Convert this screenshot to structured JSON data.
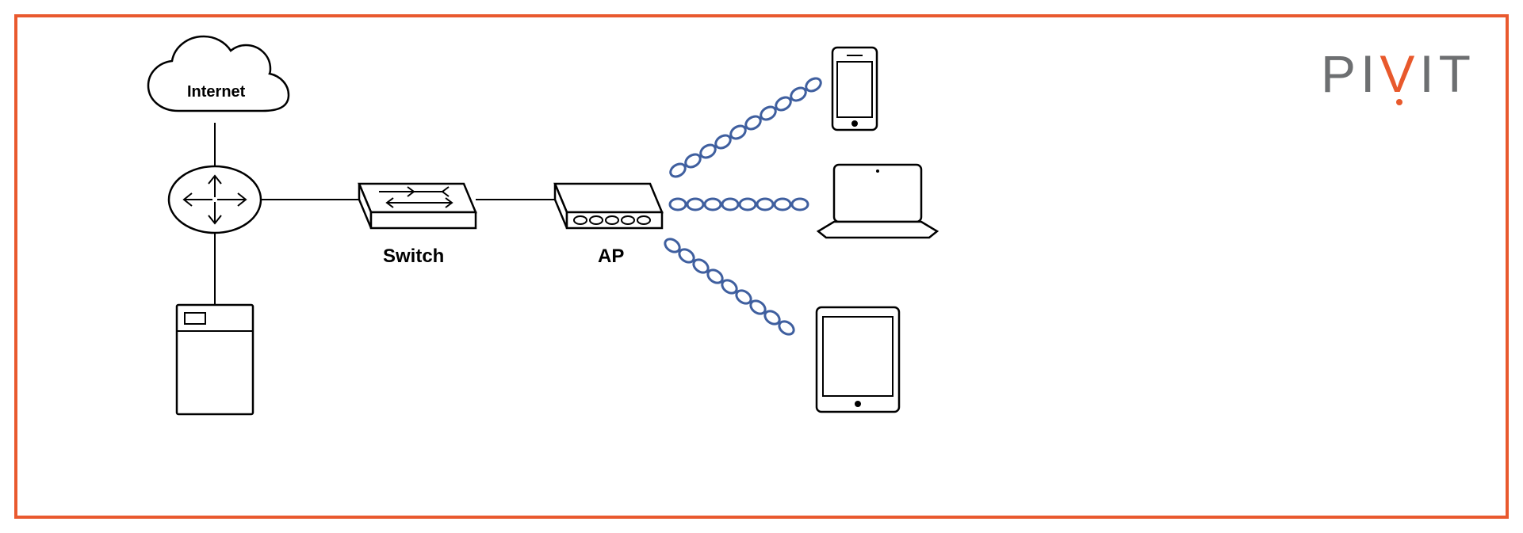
{
  "brand": {
    "name": "PIVIT"
  },
  "diagram": {
    "nodes": {
      "internet": {
        "label": "Internet"
      },
      "router": {
        "label": ""
      },
      "server": {
        "label": ""
      },
      "switch": {
        "label": "Switch"
      },
      "ap": {
        "label": "AP"
      },
      "phone": {
        "label": ""
      },
      "laptop": {
        "label": ""
      },
      "tablet": {
        "label": ""
      }
    },
    "links": [
      {
        "from": "internet",
        "to": "router",
        "type": "wired"
      },
      {
        "from": "router",
        "to": "server",
        "type": "wired"
      },
      {
        "from": "router",
        "to": "switch",
        "type": "wired"
      },
      {
        "from": "switch",
        "to": "ap",
        "type": "wired"
      },
      {
        "from": "ap",
        "to": "phone",
        "type": "wireless"
      },
      {
        "from": "ap",
        "to": "laptop",
        "type": "wireless"
      },
      {
        "from": "ap",
        "to": "tablet",
        "type": "wireless"
      }
    ]
  }
}
